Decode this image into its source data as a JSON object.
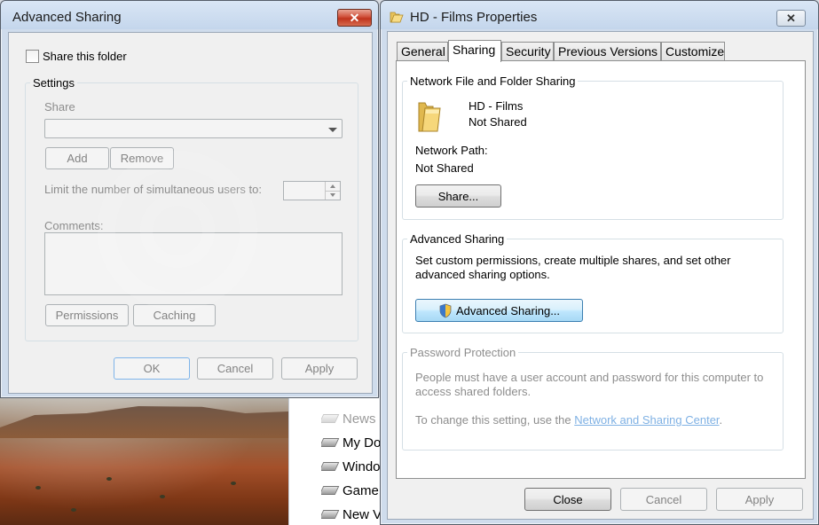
{
  "advanced_dialog": {
    "title": "Advanced Sharing",
    "close_glyph": "✕",
    "share_checkbox_label": "Share this folder",
    "share_checked": false,
    "settings_group_title": "Settings",
    "share_name_label": "Share",
    "share_name_value": "",
    "add_label": "Add",
    "remove_label": "Remove",
    "limit_label": "Limit the number of simultaneous users to:",
    "limit_value": "",
    "comments_label": "Comments:",
    "comments_value": "",
    "permissions_label": "Permissions",
    "caching_label": "Caching",
    "ok_label": "OK",
    "cancel_label": "Cancel",
    "apply_label": "Apply"
  },
  "properties_dialog": {
    "title": "HD - Films Properties",
    "close_glyph": "✕",
    "tabs": [
      {
        "label": "General"
      },
      {
        "label": "Sharing"
      },
      {
        "label": "Security"
      },
      {
        "label": "Previous Versions"
      },
      {
        "label": "Customize"
      }
    ],
    "active_tab": "Sharing",
    "network_group_title": "Network File and Folder Sharing",
    "folder_name": "HD - Films",
    "folder_status": "Not Shared",
    "network_path_label": "Network Path:",
    "network_path_value": "Not Shared",
    "share_button_label": "Share...",
    "advanced_group_title": "Advanced Sharing",
    "advanced_description": "Set custom permissions, create multiple shares, and set other advanced sharing options.",
    "advanced_button_label": "Advanced Sharing...",
    "password_group_title": "Password Protection",
    "password_description": "People must have a user account and password for this computer to access shared folders.",
    "password_change_prefix": "To change this setting, use the ",
    "password_change_link": "Network and Sharing Center",
    "password_change_suffix": ".",
    "close_label": "Close",
    "cancel_label": "Cancel",
    "apply_label": "Apply"
  },
  "explorer_list": {
    "items": [
      {
        "label": "News",
        "faded": true
      },
      {
        "label": "My Do",
        "faded": false
      },
      {
        "label": "Windo",
        "faded": false
      },
      {
        "label": "Game",
        "faded": false
      },
      {
        "label": "New V",
        "faded": false
      }
    ]
  },
  "colors": {
    "accent_link": "#0066cc",
    "close_red": "#c0341d",
    "window_frame": "#cfdcec"
  }
}
